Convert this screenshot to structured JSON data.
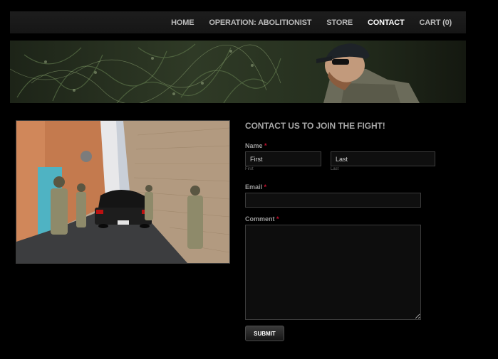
{
  "nav": {
    "items": [
      {
        "label": "HOME",
        "active": false
      },
      {
        "label": "OPERATION: ABOLITIONIST",
        "active": false
      },
      {
        "label": "STORE",
        "active": false
      },
      {
        "label": "CONTACT",
        "active": true
      },
      {
        "label": "CART (0)",
        "active": false
      }
    ]
  },
  "contact": {
    "heading": "CONTACT US TO JOIN THE FIGHT!",
    "name_label": "Name",
    "required_mark": "*",
    "first_value": "First",
    "last_value": "Last",
    "first_sublabel": "First",
    "last_sublabel": "Last",
    "email_label": "Email",
    "comment_label": "Comment",
    "submit_label": "SUBMIT"
  },
  "colors": {
    "background": "#000000",
    "navbar": "#1a1a1a",
    "nav_text": "#b9b9b9",
    "nav_active": "#ffffff",
    "required": "#c8102e"
  }
}
